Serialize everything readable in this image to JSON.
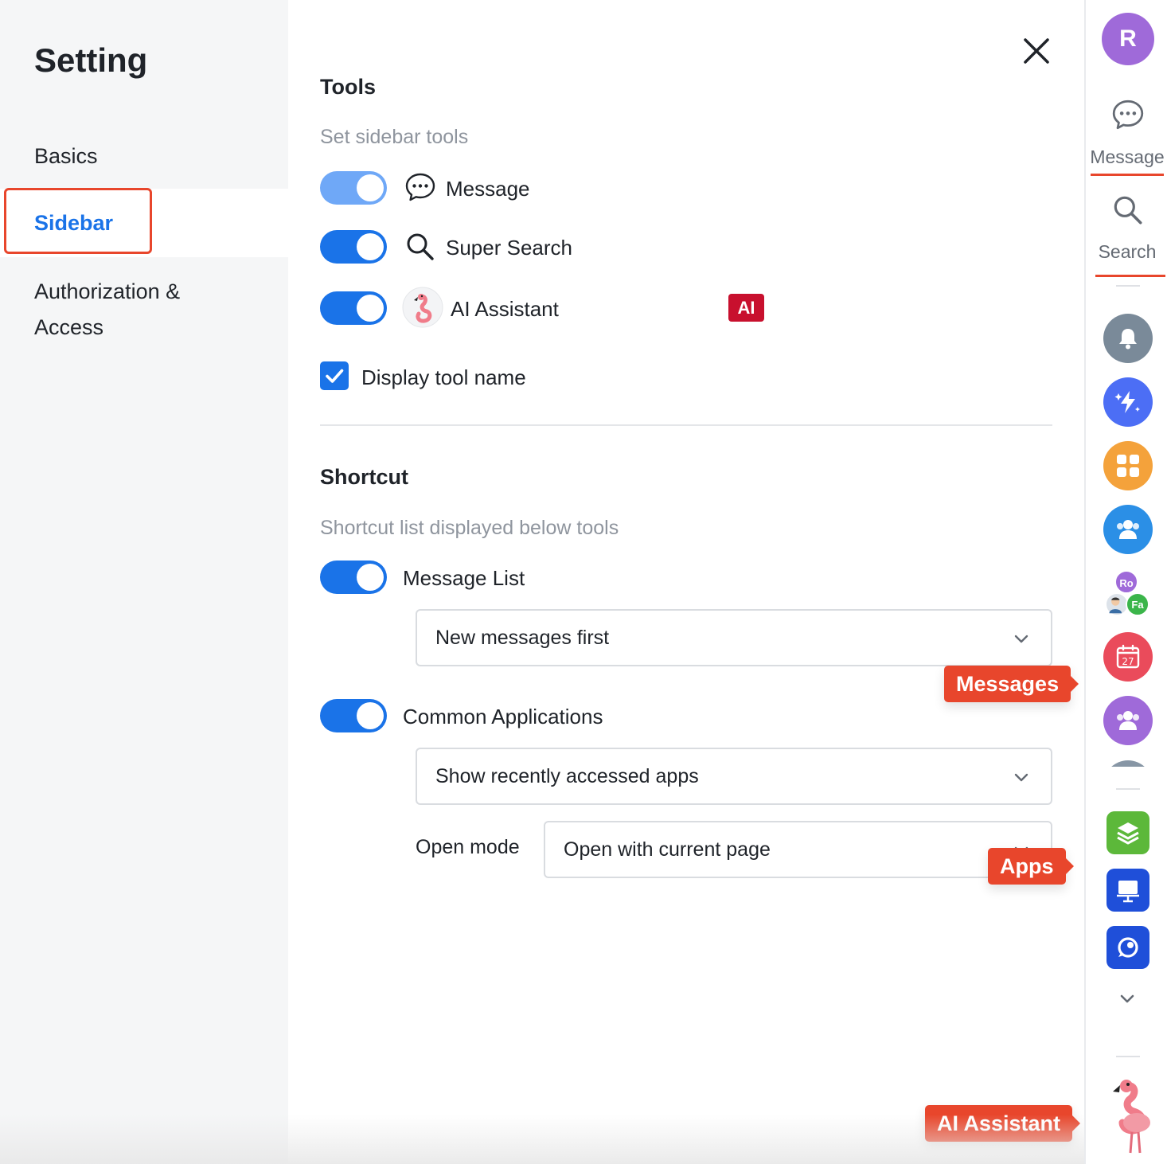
{
  "nav": {
    "title": "Setting",
    "items": [
      {
        "label": "Basics"
      },
      {
        "label": "Sidebar"
      },
      {
        "label": "Authorization & Access"
      }
    ]
  },
  "tools": {
    "title": "Tools",
    "subtitle": "Set sidebar tools",
    "items": [
      {
        "label": "Message",
        "enabled": true,
        "icon": "message-icon"
      },
      {
        "label": "Super Search",
        "enabled": true,
        "icon": "search-icon"
      },
      {
        "label": "AI Assistant",
        "enabled": true,
        "icon": "flamingo-icon",
        "badge": "AI"
      }
    ],
    "display_name": {
      "label": "Display tool name",
      "checked": true
    }
  },
  "shortcut": {
    "title": "Shortcut",
    "subtitle": "Shortcut list displayed below tools",
    "message_list": {
      "label": "Message List",
      "enabled": true,
      "select_value": "New messages first"
    },
    "common_apps": {
      "label": "Common Applications",
      "enabled": true,
      "select_value": "Show recently accessed apps",
      "open_mode_label": "Open mode",
      "open_mode_value": "Open with current page"
    }
  },
  "rail": {
    "avatar_initial": "R",
    "tools": [
      {
        "label": "Message",
        "icon": "message-icon"
      },
      {
        "label": "Search",
        "icon": "search-icon"
      }
    ],
    "group_avatar_initials": [
      "Ro",
      "Fa"
    ],
    "calendar_date": "27"
  },
  "callouts": {
    "messages": "Messages",
    "apps": "Apps",
    "ai_assistant": "AI Assistant"
  },
  "colors": {
    "accent": "#1a73e8",
    "highlight": "#e8462c",
    "ai_badge": "#c8102e"
  }
}
